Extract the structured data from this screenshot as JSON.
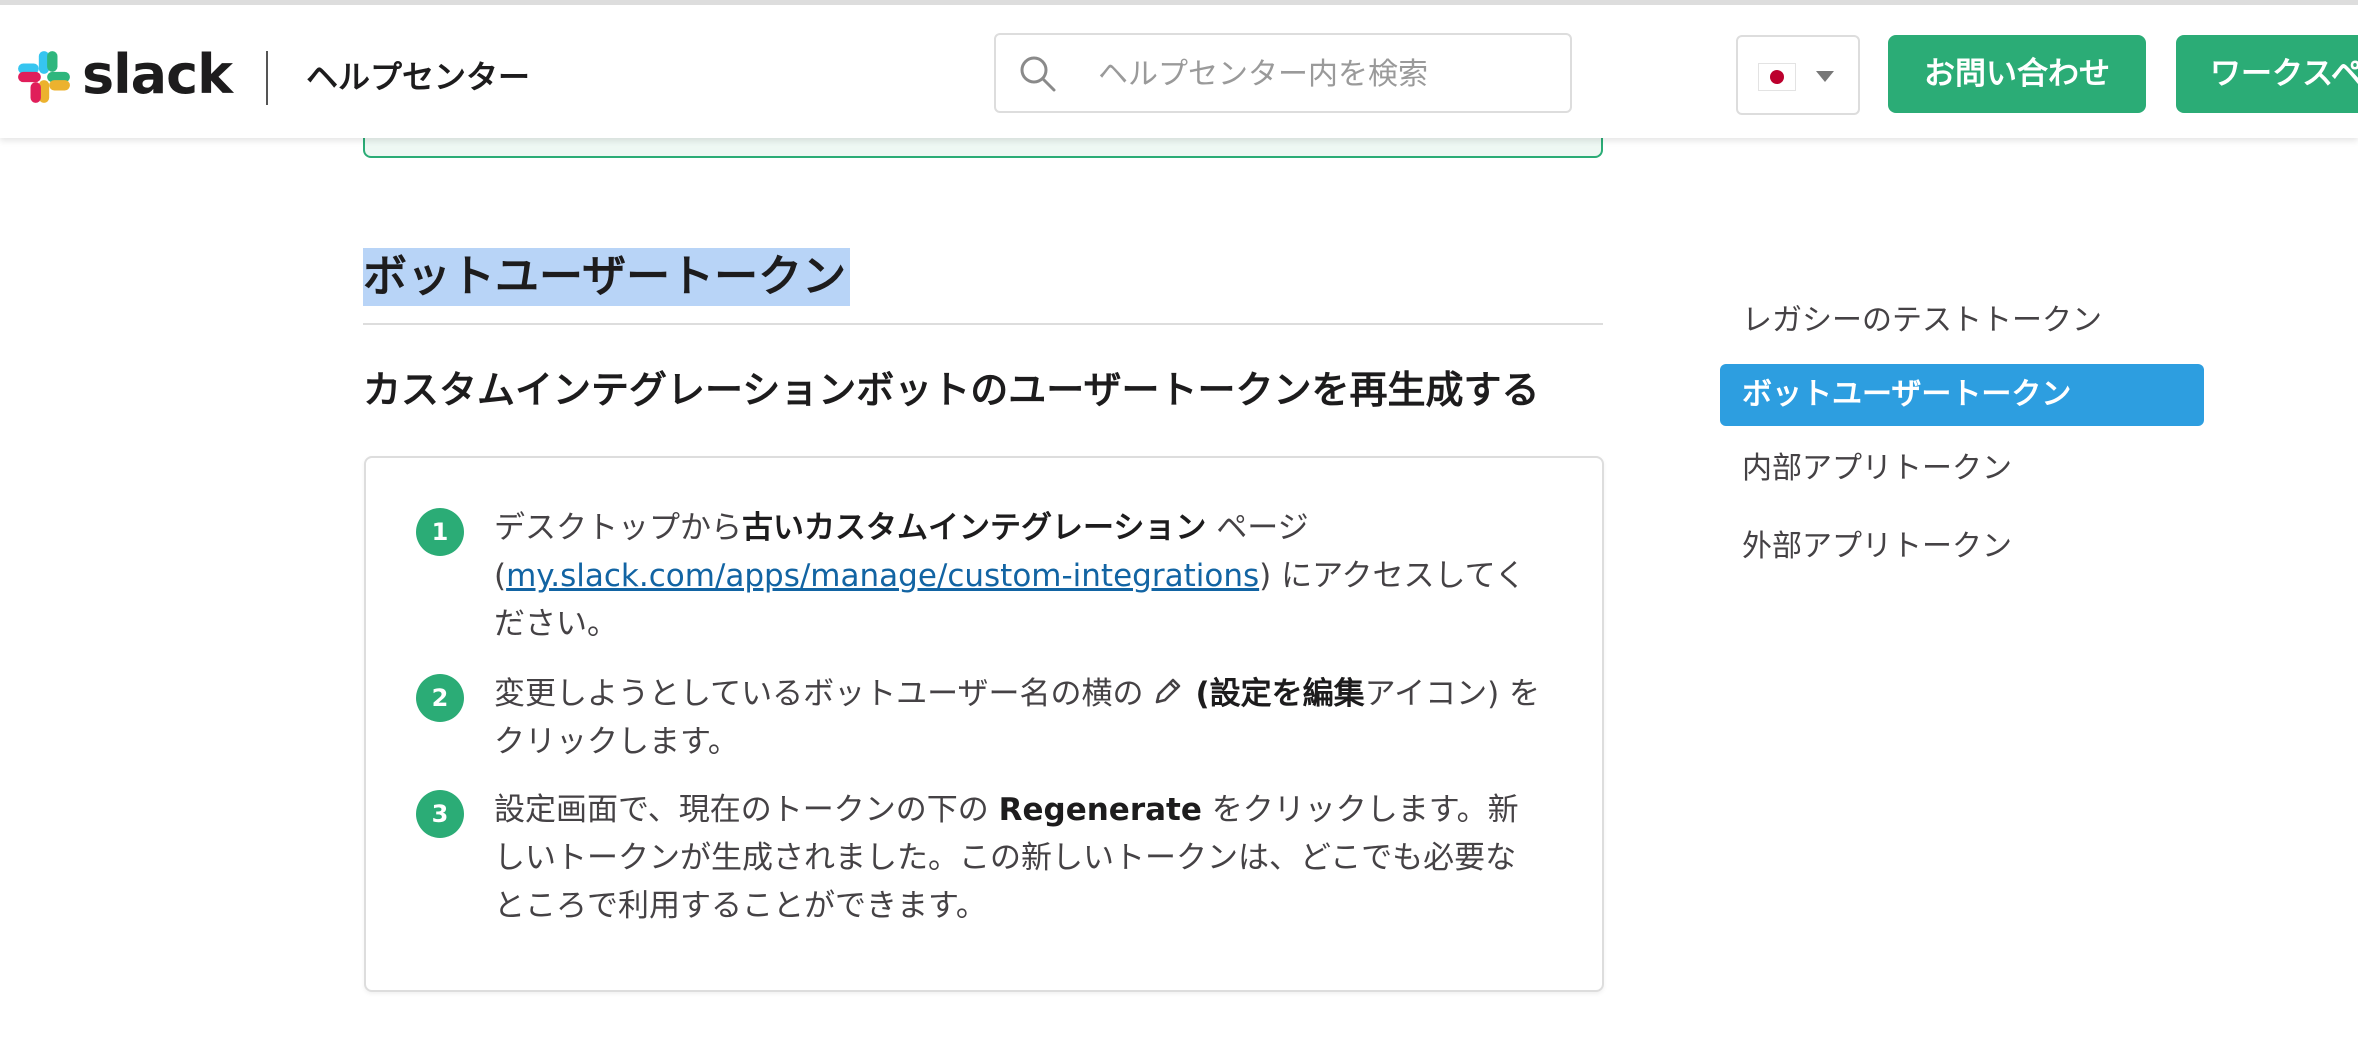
{
  "header": {
    "brand": "slack",
    "help_center": "ヘルプセンター",
    "search_placeholder": "ヘルプセンター内を検索",
    "contact_label": "お問い合わせ",
    "workspace_label": "ワークスペース"
  },
  "main": {
    "section_title": "ボットユーザートークン",
    "sub_title": "カスタムインテグレーションボットのユーザートークンを再生成する",
    "steps": [
      {
        "num": "1",
        "t1": "デスクトップから",
        "b1": "古いカスタムインテグレーション",
        "t2": " ページ (",
        "link": "my.slack.com/apps/manage/custom-integrations",
        "t3": ") にアクセスしてください。"
      },
      {
        "num": "2",
        "t1": "変更しようとしているボットユーザー名の横の",
        "t2": "(",
        "b1": "設定を編集",
        "t3": "アイコン) をクリックします。"
      },
      {
        "num": "3",
        "t1": "設定画面で、現在のトークンの下の ",
        "b1": "Regenerate",
        "t2": " をクリックします。新しいトークンが生成されました。この新しいトークンは、どこでも必要なところで利用することができます。"
      }
    ]
  },
  "toc": {
    "items": [
      {
        "label": "レガシーのテストトークン"
      },
      {
        "label": "ボットユーザートークン"
      },
      {
        "label": "内部アプリトークン"
      },
      {
        "label": "外部アプリトークン"
      }
    ],
    "active_index": 1
  },
  "colors": {
    "brand_green": "#2bac76",
    "active_blue": "#2d9ee0",
    "link_blue": "#1264a3",
    "selection": "#b8d4f7"
  }
}
